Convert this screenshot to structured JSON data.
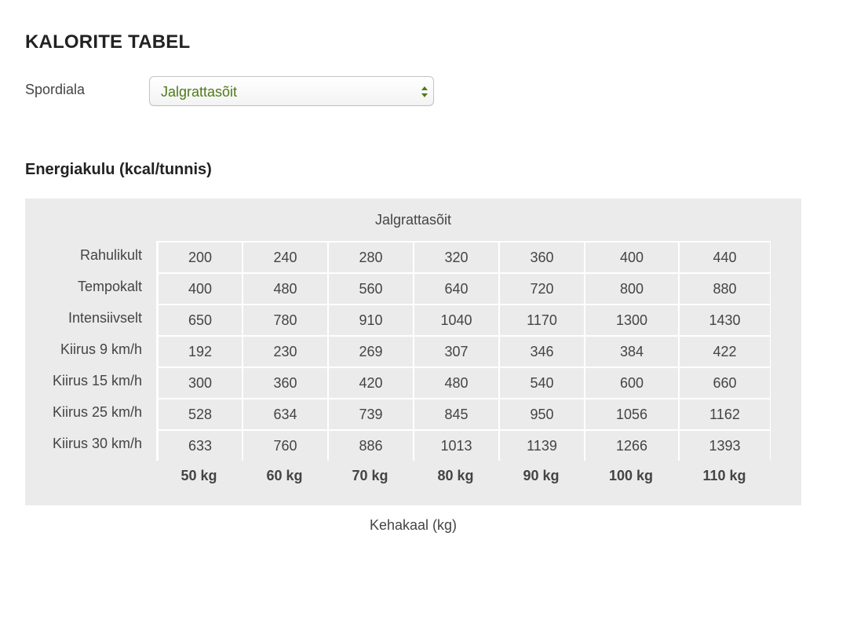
{
  "page": {
    "title": "KALORITE TABEL"
  },
  "sport": {
    "label": "Spordiala",
    "selected": "Jalgrattasõit",
    "icon": "up-down-arrows-icon"
  },
  "section": {
    "title": "Energiakulu (kcal/tunnis)"
  },
  "colors": {
    "accent": "#4f7a1a",
    "panel": "#ebebeb",
    "grid_line": "#ffffff",
    "text": "#444444"
  },
  "chart_data": {
    "type": "table",
    "title": "Jalgrattasõit",
    "xlabel": "Kehakaal (kg)",
    "columns": [
      "50 kg",
      "60 kg",
      "70 kg",
      "80 kg",
      "90 kg",
      "100 kg",
      "110 kg"
    ],
    "rows": [
      {
        "label": "Rahulikult",
        "values": [
          200,
          240,
          280,
          320,
          360,
          400,
          440
        ]
      },
      {
        "label": "Tempokalt",
        "values": [
          400,
          480,
          560,
          640,
          720,
          800,
          880
        ]
      },
      {
        "label": "Intensiivselt",
        "values": [
          650,
          780,
          910,
          1040,
          1170,
          1300,
          1430
        ]
      },
      {
        "label": "Kiirus 9 km/h",
        "values": [
          192,
          230,
          269,
          307,
          346,
          384,
          422
        ]
      },
      {
        "label": "Kiirus 15 km/h",
        "values": [
          300,
          360,
          420,
          480,
          540,
          600,
          660
        ]
      },
      {
        "label": "Kiirus 25 km/h",
        "values": [
          528,
          634,
          739,
          845,
          950,
          1056,
          1162
        ]
      },
      {
        "label": "Kiirus 30 km/h",
        "values": [
          633,
          760,
          886,
          1013,
          1139,
          1266,
          1393
        ]
      }
    ]
  }
}
